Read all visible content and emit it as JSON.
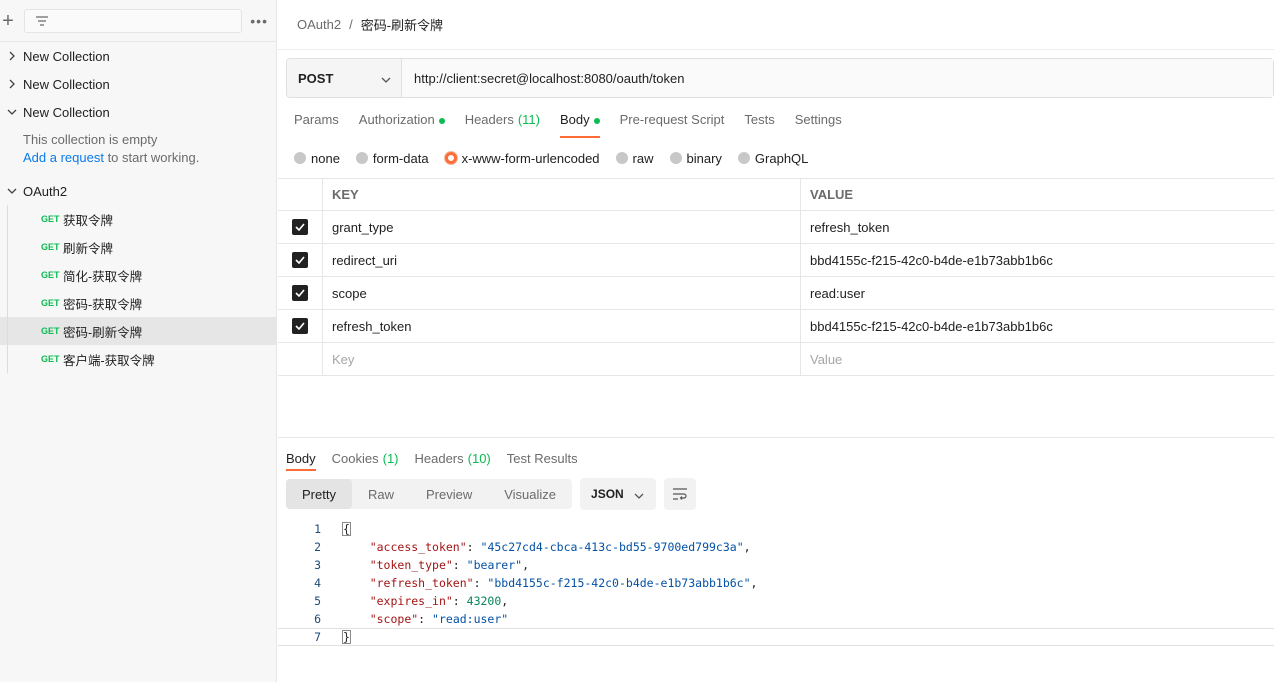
{
  "sidebar": {
    "collections": [
      {
        "name": "New Collection",
        "expanded": false
      },
      {
        "name": "New Collection",
        "expanded": false
      },
      {
        "name": "New Collection",
        "expanded": true
      }
    ],
    "empty_note": {
      "line1": "This collection is empty",
      "link": "Add a request",
      "rest": " to start working."
    },
    "oauth_collection": "OAuth2",
    "requests": [
      {
        "method": "GET",
        "name": "获取令牌"
      },
      {
        "method": "GET",
        "name": "刷新令牌"
      },
      {
        "method": "GET",
        "name": "简化-获取令牌"
      },
      {
        "method": "GET",
        "name": "密码-获取令牌"
      },
      {
        "method": "GET",
        "name": "密码-刷新令牌"
      },
      {
        "method": "GET",
        "name": "客户端-获取令牌"
      }
    ]
  },
  "breadcrumb": {
    "parent": "OAuth2",
    "sep": "/",
    "current": "密码-刷新令牌"
  },
  "request": {
    "method": "POST",
    "url": "http://client:secret@localhost:8080/oauth/token"
  },
  "req_tabs": {
    "params": "Params",
    "authorization": "Authorization",
    "headers": "Headers",
    "headers_count": "(11)",
    "body": "Body",
    "prerequest": "Pre-request Script",
    "tests": "Tests",
    "settings": "Settings"
  },
  "body_types": [
    "none",
    "form-data",
    "x-www-form-urlencoded",
    "raw",
    "binary",
    "GraphQL"
  ],
  "kv": {
    "head_key": "KEY",
    "head_value": "VALUE",
    "rows": [
      {
        "key": "grant_type",
        "value": "refresh_token"
      },
      {
        "key": "redirect_uri",
        "value": "bbd4155c-f215-42c0-b4de-e1b73abb1b6c"
      },
      {
        "key": "scope",
        "value": "read:user"
      },
      {
        "key": "refresh_token",
        "value": "bbd4155c-f215-42c0-b4de-e1b73abb1b6c"
      }
    ],
    "placeholder_key": "Key",
    "placeholder_value": "Value"
  },
  "resp_tabs": {
    "body": "Body",
    "cookies": "Cookies",
    "cookies_count": "(1)",
    "headers": "Headers",
    "headers_count": "(10)",
    "test_results": "Test Results"
  },
  "view_modes": [
    "Pretty",
    "Raw",
    "Preview",
    "Visualize"
  ],
  "format": "JSON",
  "response_json": {
    "access_token": "45c27cd4-cbca-413c-bd55-9700ed799c3a",
    "token_type": "bearer",
    "refresh_token": "bbd4155c-f215-42c0-b4de-e1b73abb1b6c",
    "expires_in": "43200",
    "scope": "read:user"
  },
  "colors": {
    "accent": "#ff6c37",
    "green": "#0cbb52",
    "link": "#097bed"
  }
}
